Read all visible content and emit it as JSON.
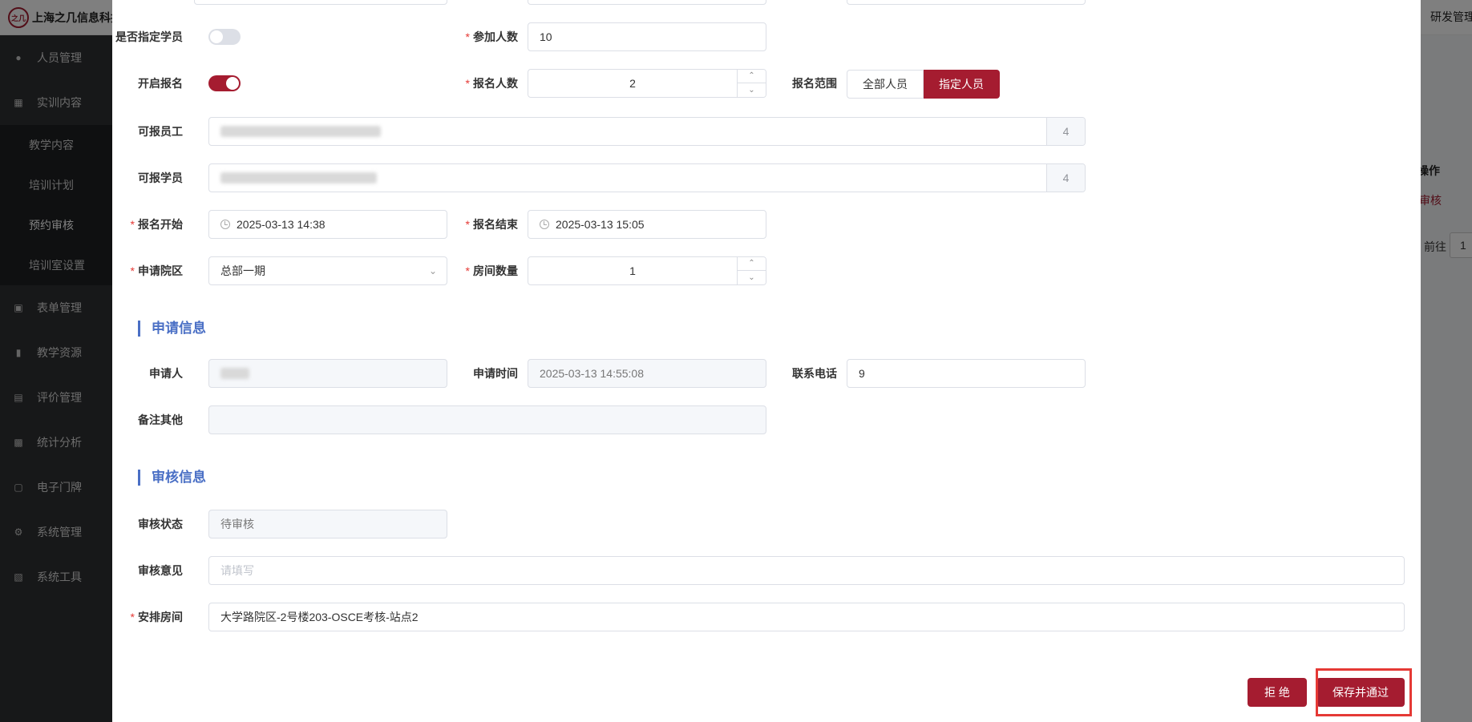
{
  "app": {
    "brand": "上海之几信息科技有限公司",
    "logo_text": "之几",
    "topbar_right": "研发管理"
  },
  "sidebar": {
    "items": [
      {
        "label": "人员管理",
        "icon": "user-icon"
      },
      {
        "label": "实训内容",
        "icon": "book-icon"
      },
      {
        "label": "表单管理",
        "icon": "form-icon"
      },
      {
        "label": "教学资源",
        "icon": "resource-icon"
      },
      {
        "label": "评价管理",
        "icon": "evaluate-icon"
      },
      {
        "label": "统计分析",
        "icon": "chart-icon"
      },
      {
        "label": "电子门牌",
        "icon": "monitor-icon"
      },
      {
        "label": "系统管理",
        "icon": "gear-icon"
      },
      {
        "label": "系统工具",
        "icon": "toolbox-icon"
      }
    ],
    "subitems": [
      {
        "label": "教学内容"
      },
      {
        "label": "培训计划"
      },
      {
        "label": "预约审核",
        "active": true
      },
      {
        "label": "培训室设置"
      }
    ]
  },
  "background": {
    "op_header": "操作",
    "audit_link": "审核",
    "goto_label": "前往",
    "page_value": "1"
  },
  "form": {
    "assign_student": {
      "label": "是否指定学员",
      "on": false
    },
    "participants": {
      "label": "参加人数",
      "value": "10"
    },
    "open_signup": {
      "label": "开启报名",
      "on": true
    },
    "signup_count": {
      "label": "报名人数",
      "value": "2"
    },
    "signup_scope": {
      "label": "报名范围",
      "options": [
        "全部人员",
        "指定人员"
      ],
      "selected": "指定人员"
    },
    "staff": {
      "label": "可报员工",
      "count": "4"
    },
    "students": {
      "label": "可报学员",
      "count": "4"
    },
    "signup_start": {
      "label": "报名开始",
      "value": "2025-03-13 14:38"
    },
    "signup_end": {
      "label": "报名结束",
      "value": "2025-03-13 15:05"
    },
    "campus": {
      "label": "申请院区",
      "value": "总部一期"
    },
    "room_count": {
      "label": "房间数量",
      "value": "1"
    }
  },
  "apply_section": {
    "title": "申请信息",
    "applicant": {
      "label": "申请人"
    },
    "apply_time": {
      "label": "申请时间",
      "value": "2025-03-13 14:55:08"
    },
    "phone": {
      "label": "联系电话",
      "value": "9"
    },
    "remark": {
      "label": "备注其他",
      "value": ""
    }
  },
  "review_section": {
    "title": "审核信息",
    "status": {
      "label": "审核状态",
      "value": "待审核"
    },
    "opinion": {
      "label": "审核意见",
      "placeholder": "请填写"
    },
    "room": {
      "label": "安排房间",
      "value": "大学路院区-2号楼203-OSCE考核-站点2"
    }
  },
  "actions": {
    "reject_label": "拒 绝",
    "approve_label": "保存并通过"
  },
  "colors": {
    "primary": "#a51c30",
    "section": "#4a6fc5",
    "required": "#e53935"
  }
}
